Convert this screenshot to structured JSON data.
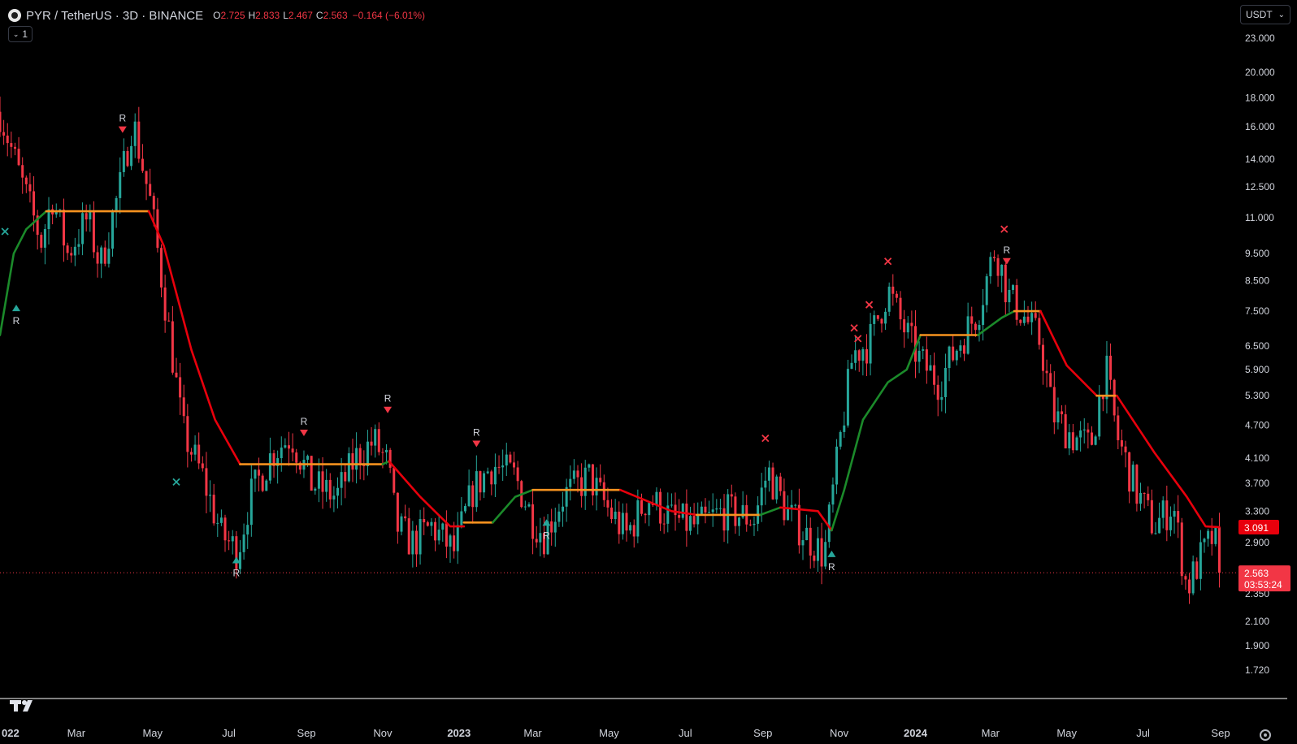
{
  "header": {
    "symbol": "PYR / TetherUS · 3D · BINANCE",
    "ohlc": [
      {
        "key": "O",
        "value": "2.725"
      },
      {
        "key": "H",
        "value": "2.833"
      },
      {
        "key": "L",
        "value": "2.467"
      },
      {
        "key": "C",
        "value": "2.563"
      }
    ],
    "change": "−0.164 (−6.01%)",
    "interval_label": "1",
    "currency": "USDT"
  },
  "colors": {
    "up": "#26a69a",
    "down": "#f23645",
    "trend_up": "#1b8a2a",
    "trend_down": "#e8000c",
    "trend_flat": "#f5921f",
    "grid": "#000000",
    "text": "#d1d4dc",
    "axis_line": "#ffffff"
  },
  "chart_data": {
    "type": "candlestick",
    "y_scale": "log",
    "ylim": [
      1.55,
      24.5
    ],
    "x_range": [
      "2021-12-30",
      "2024-09-14"
    ],
    "y_ticks": [
      "23.000",
      "20.000",
      "18.000",
      "16.000",
      "14.000",
      "12.500",
      "11.000",
      "9.500",
      "8.500",
      "7.500",
      "6.500",
      "5.900",
      "5.300",
      "4.700",
      "4.100",
      "3.700",
      "3.300",
      "2.900",
      "2.350",
      "2.100",
      "1.900",
      "1.720"
    ],
    "x_ticks": [
      {
        "label": "022",
        "date": "2022-01-01",
        "bold": true
      },
      {
        "label": "Mar",
        "date": "2022-03-01"
      },
      {
        "label": "May",
        "date": "2022-05-01"
      },
      {
        "label": "Jul",
        "date": "2022-07-01"
      },
      {
        "label": "Sep",
        "date": "2022-09-01"
      },
      {
        "label": "Nov",
        "date": "2022-11-01"
      },
      {
        "label": "2023",
        "date": "2023-01-01",
        "bold": true
      },
      {
        "label": "Mar",
        "date": "2023-03-01"
      },
      {
        "label": "May",
        "date": "2023-05-01"
      },
      {
        "label": "Jul",
        "date": "2023-07-01"
      },
      {
        "label": "Sep",
        "date": "2023-09-01"
      },
      {
        "label": "Nov",
        "date": "2023-11-01"
      },
      {
        "label": "2024",
        "date": "2024-01-01",
        "bold": true
      },
      {
        "label": "Mar",
        "date": "2024-03-01"
      },
      {
        "label": "May",
        "date": "2024-05-01"
      },
      {
        "label": "Jul",
        "date": "2024-07-01"
      },
      {
        "label": "Sep",
        "date": "2024-09-01"
      }
    ],
    "close_path": [
      [
        "2021-12-30",
        17
      ],
      [
        "2022-01-15",
        13
      ],
      [
        "2022-02-01",
        10
      ],
      [
        "2022-02-10",
        12
      ],
      [
        "2022-02-22",
        9.5
      ],
      [
        "2022-03-10",
        11
      ],
      [
        "2022-03-20",
        9
      ],
      [
        "2022-04-05",
        12.5
      ],
      [
        "2022-04-15",
        16.5
      ],
      [
        "2022-04-30",
        11.5
      ],
      [
        "2022-05-12",
        7.5
      ],
      [
        "2022-05-25",
        4.6
      ],
      [
        "2022-06-10",
        3.8
      ],
      [
        "2022-06-25",
        3.0
      ],
      [
        "2022-07-08",
        2.8
      ],
      [
        "2022-07-18",
        3.5
      ],
      [
        "2022-08-05",
        4.2
      ],
      [
        "2022-08-20",
        4.5
      ],
      [
        "2022-09-05",
        3.7
      ],
      [
        "2022-09-25",
        3.5
      ],
      [
        "2022-10-10",
        4.1
      ],
      [
        "2022-10-25",
        4.4
      ],
      [
        "2022-11-05",
        4.0
      ],
      [
        "2022-11-12",
        3.1
      ],
      [
        "2022-11-25",
        2.9
      ],
      [
        "2022-12-10",
        3.1
      ],
      [
        "2022-12-28",
        2.8
      ],
      [
        "2023-01-12",
        3.6
      ],
      [
        "2023-01-28",
        4.0
      ],
      [
        "2023-02-15",
        3.8
      ],
      [
        "2023-03-01",
        3.2
      ],
      [
        "2023-03-10",
        3.0
      ],
      [
        "2023-03-25",
        3.5
      ],
      [
        "2023-04-15",
        3.8
      ],
      [
        "2023-05-01",
        3.3
      ],
      [
        "2023-05-15",
        3.0
      ],
      [
        "2023-06-01",
        3.5
      ],
      [
        "2023-06-20",
        3.2
      ],
      [
        "2023-07-10",
        3.1
      ],
      [
        "2023-08-01",
        3.3
      ],
      [
        "2023-08-25",
        3.2
      ],
      [
        "2023-09-05",
        3.9
      ],
      [
        "2023-09-20",
        3.3
      ],
      [
        "2023-10-05",
        3.0
      ],
      [
        "2023-10-20",
        2.75
      ],
      [
        "2023-11-01",
        4.3
      ],
      [
        "2023-11-12",
        6.3
      ],
      [
        "2023-11-25",
        6.6
      ],
      [
        "2023-12-10",
        8.2
      ],
      [
        "2023-12-20",
        7.2
      ],
      [
        "2024-01-05",
        6.1
      ],
      [
        "2024-01-20",
        5.6
      ],
      [
        "2024-02-05",
        6.6
      ],
      [
        "2024-02-20",
        7.5
      ],
      [
        "2024-03-05",
        9.8
      ],
      [
        "2024-03-15",
        8.0
      ],
      [
        "2024-03-25",
        7.5
      ],
      [
        "2024-04-10",
        6.6
      ],
      [
        "2024-04-20",
        4.9
      ],
      [
        "2024-05-05",
        4.5
      ],
      [
        "2024-05-20",
        4.3
      ],
      [
        "2024-06-01",
        6.0
      ],
      [
        "2024-06-10",
        4.5
      ],
      [
        "2024-06-25",
        3.6
      ],
      [
        "2024-07-10",
        3.1
      ],
      [
        "2024-07-25",
        3.4
      ],
      [
        "2024-08-05",
        2.4
      ],
      [
        "2024-08-15",
        2.7
      ],
      [
        "2024-08-27",
        3.0
      ],
      [
        "2024-08-31",
        2.563
      ]
    ],
    "trend_line": [
      {
        "color": "trend_up",
        "points": [
          [
            "2021-12-30",
            6.8
          ],
          [
            "2022-01-10",
            9.5
          ],
          [
            "2022-01-20",
            10.5
          ],
          [
            "2022-02-05",
            11.3
          ]
        ]
      },
      {
        "color": "trend_flat",
        "points": [
          [
            "2022-02-05",
            11.3
          ],
          [
            "2022-04-28",
            11.3
          ]
        ]
      },
      {
        "color": "trend_down",
        "points": [
          [
            "2022-04-28",
            11.3
          ],
          [
            "2022-05-10",
            9.8
          ],
          [
            "2022-06-01",
            6.4
          ],
          [
            "2022-06-20",
            4.8
          ],
          [
            "2022-07-10",
            4.0
          ]
        ]
      },
      {
        "color": "trend_flat",
        "points": [
          [
            "2022-07-10",
            4.0
          ],
          [
            "2022-11-01",
            4.0
          ]
        ]
      },
      {
        "color": "trend_up",
        "points": [
          [
            "2022-11-01",
            4.0
          ],
          [
            "2022-11-06",
            4.05
          ]
        ]
      },
      {
        "color": "trend_down",
        "points": [
          [
            "2022-11-06",
            4.05
          ],
          [
            "2022-12-01",
            3.5
          ],
          [
            "2022-12-25",
            3.1
          ],
          [
            "2023-01-05",
            3.1
          ]
        ]
      },
      {
        "color": "trend_flat",
        "points": [
          [
            "2023-01-05",
            3.15
          ],
          [
            "2023-01-28",
            3.15
          ]
        ]
      },
      {
        "color": "trend_up",
        "points": [
          [
            "2023-01-28",
            3.15
          ],
          [
            "2023-02-15",
            3.5
          ],
          [
            "2023-03-01",
            3.6
          ]
        ]
      },
      {
        "color": "trend_flat",
        "points": [
          [
            "2023-03-01",
            3.6
          ],
          [
            "2023-05-10",
            3.6
          ]
        ]
      },
      {
        "color": "trend_down",
        "points": [
          [
            "2023-05-10",
            3.6
          ],
          [
            "2023-06-20",
            3.3
          ],
          [
            "2023-07-10",
            3.25
          ]
        ]
      },
      {
        "color": "trend_flat",
        "points": [
          [
            "2023-07-10",
            3.25
          ],
          [
            "2023-08-30",
            3.25
          ]
        ]
      },
      {
        "color": "trend_up",
        "points": [
          [
            "2023-08-30",
            3.25
          ],
          [
            "2023-09-15",
            3.35
          ]
        ]
      },
      {
        "color": "trend_down",
        "points": [
          [
            "2023-09-15",
            3.35
          ],
          [
            "2023-10-15",
            3.3
          ],
          [
            "2023-10-26",
            3.05
          ]
        ]
      },
      {
        "color": "trend_up",
        "points": [
          [
            "2023-10-26",
            3.05
          ],
          [
            "2023-11-05",
            3.6
          ],
          [
            "2023-11-20",
            4.8
          ],
          [
            "2023-12-10",
            5.6
          ],
          [
            "2023-12-25",
            5.9
          ],
          [
            "2024-01-05",
            6.8
          ]
        ]
      },
      {
        "color": "trend_flat",
        "points": [
          [
            "2024-01-05",
            6.8
          ],
          [
            "2024-02-20",
            6.8
          ]
        ]
      },
      {
        "color": "trend_up",
        "points": [
          [
            "2024-02-20",
            6.8
          ],
          [
            "2024-03-10",
            7.3
          ],
          [
            "2024-03-20",
            7.5
          ]
        ]
      },
      {
        "color": "trend_flat",
        "points": [
          [
            "2024-03-20",
            7.5
          ],
          [
            "2024-04-10",
            7.5
          ]
        ]
      },
      {
        "color": "trend_down",
        "points": [
          [
            "2024-04-10",
            7.5
          ],
          [
            "2024-05-01",
            6.0
          ],
          [
            "2024-05-25",
            5.3
          ]
        ]
      },
      {
        "color": "trend_flat",
        "points": [
          [
            "2024-05-25",
            5.3
          ],
          [
            "2024-06-10",
            5.3
          ]
        ]
      },
      {
        "color": "trend_down",
        "points": [
          [
            "2024-06-10",
            5.3
          ],
          [
            "2024-07-10",
            4.2
          ],
          [
            "2024-08-05",
            3.5
          ],
          [
            "2024-08-20",
            3.1
          ],
          [
            "2024-08-31",
            3.09
          ]
        ]
      }
    ],
    "markers": [
      {
        "date": "2022-01-03",
        "price": 10.4,
        "shape": "x",
        "color": "up"
      },
      {
        "date": "2022-01-12",
        "price": 7.6,
        "shape": "triangle-up",
        "color": "up",
        "label": "R"
      },
      {
        "date": "2022-04-07",
        "price": 15.8,
        "shape": "triangle-down",
        "color": "down",
        "label": "R"
      },
      {
        "date": "2022-05-20",
        "price": 3.72,
        "shape": "x",
        "color": "up"
      },
      {
        "date": "2022-07-07",
        "price": 2.7,
        "shape": "triangle-up",
        "color": "up",
        "label": "R"
      },
      {
        "date": "2022-08-30",
        "price": 4.55,
        "shape": "triangle-down",
        "color": "down",
        "label": "R"
      },
      {
        "date": "2022-11-05",
        "price": 5.0,
        "shape": "triangle-down",
        "color": "down",
        "label": "R"
      },
      {
        "date": "2023-01-15",
        "price": 4.35,
        "shape": "triangle-down",
        "color": "down",
        "label": "R"
      },
      {
        "date": "2023-03-12",
        "price": 3.15,
        "shape": "triangle-up",
        "color": "up",
        "label": "R"
      },
      {
        "date": "2023-09-03",
        "price": 4.45,
        "shape": "x",
        "color": "down"
      },
      {
        "date": "2023-10-26",
        "price": 2.77,
        "shape": "triangle-up",
        "color": "up",
        "label": "R"
      },
      {
        "date": "2023-11-13",
        "price": 7.0,
        "shape": "x",
        "color": "down"
      },
      {
        "date": "2023-11-16",
        "price": 6.7,
        "shape": "x",
        "color": "down"
      },
      {
        "date": "2023-11-25",
        "price": 7.7,
        "shape": "x",
        "color": "down"
      },
      {
        "date": "2023-12-10",
        "price": 9.2,
        "shape": "x",
        "color": "down"
      },
      {
        "date": "2024-03-12",
        "price": 10.5,
        "shape": "x",
        "color": "down"
      },
      {
        "date": "2024-03-14",
        "price": 9.2,
        "shape": "triangle-down",
        "color": "down",
        "label": "R"
      }
    ],
    "price_labels": {
      "trend_value": "3.091",
      "trend_price": 3.091,
      "last_value": "2.563",
      "last_price": 2.563,
      "countdown": "03:53:24"
    }
  }
}
